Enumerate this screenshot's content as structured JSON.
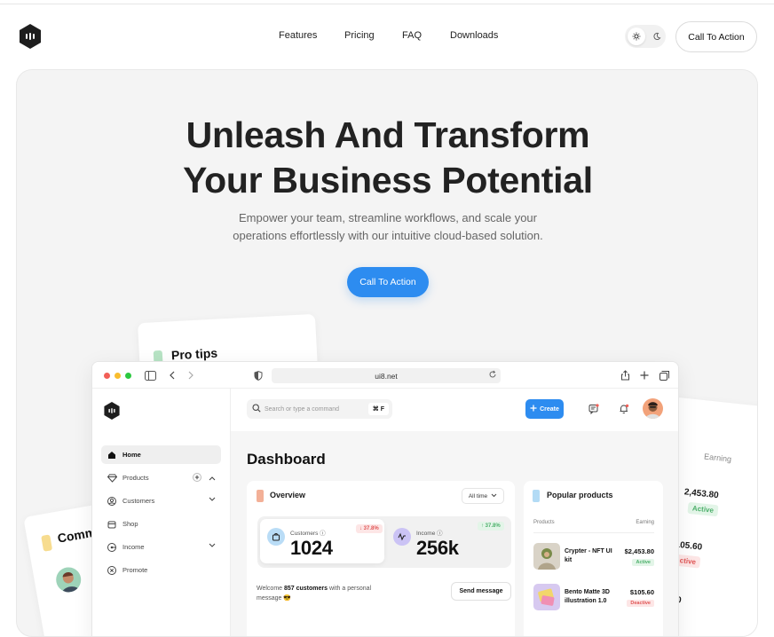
{
  "nav": {
    "links": [
      "Features",
      "Pricing",
      "FAQ",
      "Downloads"
    ],
    "cta": "Call To Action"
  },
  "hero": {
    "title_line1": "Unleash And Transform",
    "title_line2": "Your Business Potential",
    "subtitle_line1": "Empower your team, streamline workflows, and scale your",
    "subtitle_line2": "operations effortlessly with our intuitive cloud-based solution.",
    "cta": "Call To Action"
  },
  "bg_cards": {
    "tips": "Pro tips",
    "comm": "Comm",
    "earn_header": "Earning",
    "earn_values": [
      "2,453.80",
      "105.60",
      "3.60"
    ],
    "earn_badges": [
      "Active",
      "ctive"
    ]
  },
  "browser": {
    "url": "ui8.net"
  },
  "app": {
    "sidebar": [
      {
        "label": "Home",
        "icon": "home-icon"
      },
      {
        "label": "Products",
        "icon": "diamond-icon"
      },
      {
        "label": "Customers",
        "icon": "user-circle-icon"
      },
      {
        "label": "Shop",
        "icon": "shop-icon"
      },
      {
        "label": "Income",
        "icon": "income-icon"
      },
      {
        "label": "Promote",
        "icon": "promote-icon"
      }
    ],
    "search_placeholder": "Search or type a command",
    "search_shortcut": "⌘ F",
    "create_label": "Create",
    "page_title": "Dashboard",
    "overview": {
      "title": "Overview",
      "range": "All time",
      "customers_label": "Customers",
      "customers_value": "1024",
      "customers_change": "37.8%",
      "income_label": "Income",
      "income_value": "256k",
      "income_change": "37.8%",
      "welcome_prefix": "Welcome ",
      "welcome_count": "857 customers",
      "welcome_suffix": " with a personal message 😎",
      "send_label": "Send message"
    },
    "popular": {
      "title": "Popular products",
      "col_products": "Products",
      "col_earning": "Earning",
      "items": [
        {
          "name": "Crypter - NFT UI kit",
          "price": "$2,453.80",
          "status": "Active"
        },
        {
          "name": "Bento Matte 3D illustration 1.0",
          "price": "$105.60",
          "status": "Deactive"
        }
      ]
    }
  },
  "colors": {
    "accent": "#2d8cf0",
    "active_green": "#4caf6a",
    "deactive_red": "#e05555"
  }
}
